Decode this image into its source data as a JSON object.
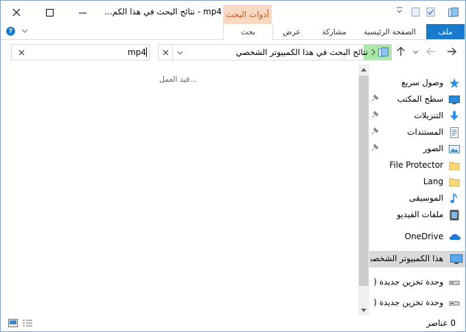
{
  "window": {
    "title": "mp4 - نتائج البحث في هذا الكم...",
    "context_tab_label": "أدوات البحث"
  },
  "ribbon": {
    "tabs": [
      {
        "label": "ملف"
      },
      {
        "label": "الصفحة الرئيسية"
      },
      {
        "label": "مشاركة"
      },
      {
        "label": "عرض"
      },
      {
        "label": "بحث"
      }
    ]
  },
  "address_bar": {
    "path": "نتائج البحث في هذا الكمبيوتر الشخصي"
  },
  "search": {
    "value": "mp4"
  },
  "content": {
    "status_text": "قيد العمل..."
  },
  "nav_pane": {
    "items": [
      {
        "label": "وصول سريع",
        "icon": "star-icon"
      },
      {
        "label": "سطح المكتب",
        "icon": "desktop-icon",
        "pinned": true
      },
      {
        "label": "التنزيلات",
        "icon": "download-icon",
        "pinned": true
      },
      {
        "label": "المستندات",
        "icon": "documents-icon",
        "pinned": true
      },
      {
        "label": "الصور",
        "icon": "pictures-icon",
        "pinned": true
      },
      {
        "label": "File Protector",
        "icon": "folder-icon"
      },
      {
        "label": "Lang",
        "icon": "folder-icon"
      },
      {
        "label": "الموسيقى",
        "icon": "music-icon"
      },
      {
        "label": "ملفات الفيديو",
        "icon": "video-icon"
      },
      {
        "label": "OneDrive",
        "icon": "cloud-icon"
      },
      {
        "label": "هذا الكمبيوتر الشخصي",
        "icon": "computer-icon"
      },
      {
        "label": "وحدة تخزين جديدة (",
        "icon": "drive-icon"
      },
      {
        "label": "وحدة تخزين جديدة (",
        "icon": "drive-icon"
      }
    ]
  },
  "status_bar": {
    "item_count": "0 عناصر"
  },
  "colors": {
    "file_tab": "#1979ca",
    "context_tab_bg": "#f9d9c3",
    "context_tab_text": "#c4521b",
    "selected_nav": "#d9d9d9"
  }
}
